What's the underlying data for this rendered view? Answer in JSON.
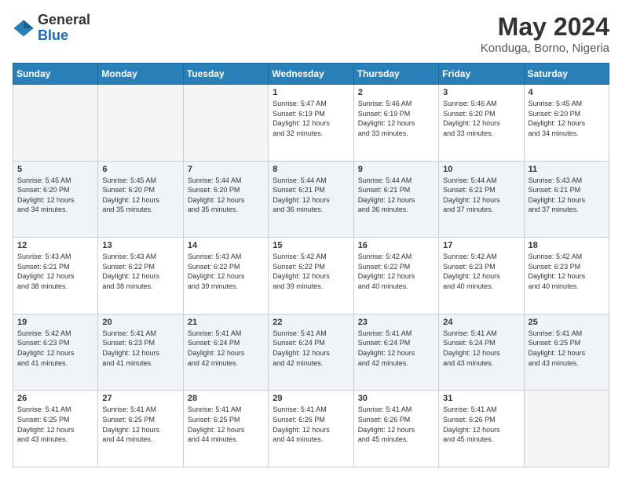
{
  "header": {
    "logo_line1": "General",
    "logo_line2": "Blue",
    "title": "May 2024",
    "subtitle": "Konduga, Borno, Nigeria"
  },
  "days_of_week": [
    "Sunday",
    "Monday",
    "Tuesday",
    "Wednesday",
    "Thursday",
    "Friday",
    "Saturday"
  ],
  "weeks": [
    [
      {
        "day": "",
        "info": ""
      },
      {
        "day": "",
        "info": ""
      },
      {
        "day": "",
        "info": ""
      },
      {
        "day": "1",
        "info": "Sunrise: 5:47 AM\nSunset: 6:19 PM\nDaylight: 12 hours\nand 32 minutes."
      },
      {
        "day": "2",
        "info": "Sunrise: 5:46 AM\nSunset: 6:19 PM\nDaylight: 12 hours\nand 33 minutes."
      },
      {
        "day": "3",
        "info": "Sunrise: 5:46 AM\nSunset: 6:20 PM\nDaylight: 12 hours\nand 33 minutes."
      },
      {
        "day": "4",
        "info": "Sunrise: 5:45 AM\nSunset: 6:20 PM\nDaylight: 12 hours\nand 34 minutes."
      }
    ],
    [
      {
        "day": "5",
        "info": "Sunrise: 5:45 AM\nSunset: 6:20 PM\nDaylight: 12 hours\nand 34 minutes."
      },
      {
        "day": "6",
        "info": "Sunrise: 5:45 AM\nSunset: 6:20 PM\nDaylight: 12 hours\nand 35 minutes."
      },
      {
        "day": "7",
        "info": "Sunrise: 5:44 AM\nSunset: 6:20 PM\nDaylight: 12 hours\nand 35 minutes."
      },
      {
        "day": "8",
        "info": "Sunrise: 5:44 AM\nSunset: 6:21 PM\nDaylight: 12 hours\nand 36 minutes."
      },
      {
        "day": "9",
        "info": "Sunrise: 5:44 AM\nSunset: 6:21 PM\nDaylight: 12 hours\nand 36 minutes."
      },
      {
        "day": "10",
        "info": "Sunrise: 5:44 AM\nSunset: 6:21 PM\nDaylight: 12 hours\nand 37 minutes."
      },
      {
        "day": "11",
        "info": "Sunrise: 5:43 AM\nSunset: 6:21 PM\nDaylight: 12 hours\nand 37 minutes."
      }
    ],
    [
      {
        "day": "12",
        "info": "Sunrise: 5:43 AM\nSunset: 6:21 PM\nDaylight: 12 hours\nand 38 minutes."
      },
      {
        "day": "13",
        "info": "Sunrise: 5:43 AM\nSunset: 6:22 PM\nDaylight: 12 hours\nand 38 minutes."
      },
      {
        "day": "14",
        "info": "Sunrise: 5:43 AM\nSunset: 6:22 PM\nDaylight: 12 hours\nand 39 minutes."
      },
      {
        "day": "15",
        "info": "Sunrise: 5:42 AM\nSunset: 6:22 PM\nDaylight: 12 hours\nand 39 minutes."
      },
      {
        "day": "16",
        "info": "Sunrise: 5:42 AM\nSunset: 6:22 PM\nDaylight: 12 hours\nand 40 minutes."
      },
      {
        "day": "17",
        "info": "Sunrise: 5:42 AM\nSunset: 6:23 PM\nDaylight: 12 hours\nand 40 minutes."
      },
      {
        "day": "18",
        "info": "Sunrise: 5:42 AM\nSunset: 6:23 PM\nDaylight: 12 hours\nand 40 minutes."
      }
    ],
    [
      {
        "day": "19",
        "info": "Sunrise: 5:42 AM\nSunset: 6:23 PM\nDaylight: 12 hours\nand 41 minutes."
      },
      {
        "day": "20",
        "info": "Sunrise: 5:41 AM\nSunset: 6:23 PM\nDaylight: 12 hours\nand 41 minutes."
      },
      {
        "day": "21",
        "info": "Sunrise: 5:41 AM\nSunset: 6:24 PM\nDaylight: 12 hours\nand 42 minutes."
      },
      {
        "day": "22",
        "info": "Sunrise: 5:41 AM\nSunset: 6:24 PM\nDaylight: 12 hours\nand 42 minutes."
      },
      {
        "day": "23",
        "info": "Sunrise: 5:41 AM\nSunset: 6:24 PM\nDaylight: 12 hours\nand 42 minutes."
      },
      {
        "day": "24",
        "info": "Sunrise: 5:41 AM\nSunset: 6:24 PM\nDaylight: 12 hours\nand 43 minutes."
      },
      {
        "day": "25",
        "info": "Sunrise: 5:41 AM\nSunset: 6:25 PM\nDaylight: 12 hours\nand 43 minutes."
      }
    ],
    [
      {
        "day": "26",
        "info": "Sunrise: 5:41 AM\nSunset: 6:25 PM\nDaylight: 12 hours\nand 43 minutes."
      },
      {
        "day": "27",
        "info": "Sunrise: 5:41 AM\nSunset: 6:25 PM\nDaylight: 12 hours\nand 44 minutes."
      },
      {
        "day": "28",
        "info": "Sunrise: 5:41 AM\nSunset: 6:25 PM\nDaylight: 12 hours\nand 44 minutes."
      },
      {
        "day": "29",
        "info": "Sunrise: 5:41 AM\nSunset: 6:26 PM\nDaylight: 12 hours\nand 44 minutes."
      },
      {
        "day": "30",
        "info": "Sunrise: 5:41 AM\nSunset: 6:26 PM\nDaylight: 12 hours\nand 45 minutes."
      },
      {
        "day": "31",
        "info": "Sunrise: 5:41 AM\nSunset: 6:26 PM\nDaylight: 12 hours\nand 45 minutes."
      },
      {
        "day": "",
        "info": ""
      }
    ]
  ]
}
